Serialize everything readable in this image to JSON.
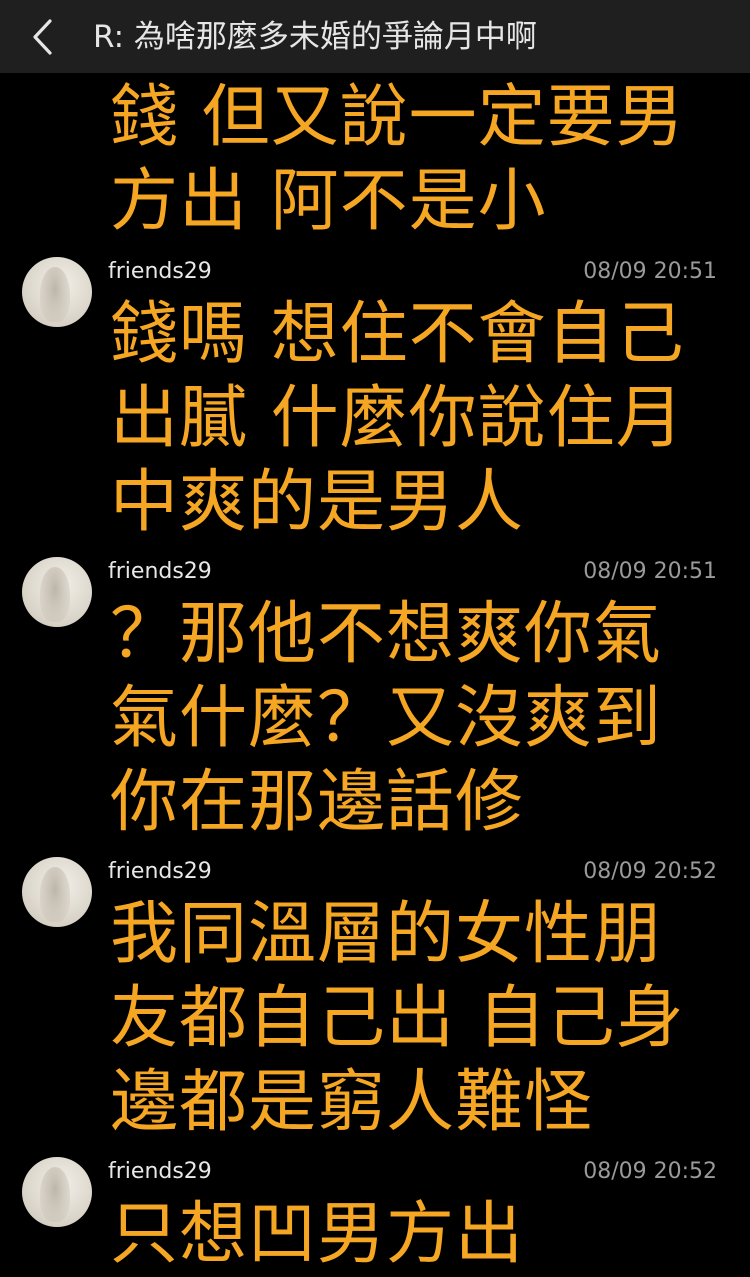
{
  "header": {
    "title": "R: 為啥那麼多未婚的爭論月中啊"
  },
  "continuation": {
    "lines": [
      "錢 但又說一定要男",
      "方出 阿不是小"
    ]
  },
  "posts": [
    {
      "username": "friends29",
      "timestamp": "08/09 20:51",
      "lines": [
        "錢嗎 想住不會自己",
        "出膩 什麼你說住月",
        "中爽的是男人"
      ]
    },
    {
      "username": "friends29",
      "timestamp": "08/09 20:51",
      "lines": [
        "？那他不想爽你氣",
        "氣什麼？又沒爽到",
        "你在那邊話修"
      ]
    },
    {
      "username": "friends29",
      "timestamp": "08/09 20:52",
      "lines": [
        "我同溫層的女性朋",
        "友都自己出 自己身",
        "邊都是窮人難怪"
      ]
    },
    {
      "username": "friends29",
      "timestamp": "08/09 20:52",
      "lines": [
        "只想凹男方出"
      ]
    }
  ],
  "icons": {
    "back": "chevron-left-icon",
    "avatar": "user-avatar"
  },
  "colors": {
    "background": "#000000",
    "topbar": "#1f1f1f",
    "message_text": "#f5a623",
    "username": "#e8e8e8",
    "timestamp": "#9a9a9a"
  }
}
